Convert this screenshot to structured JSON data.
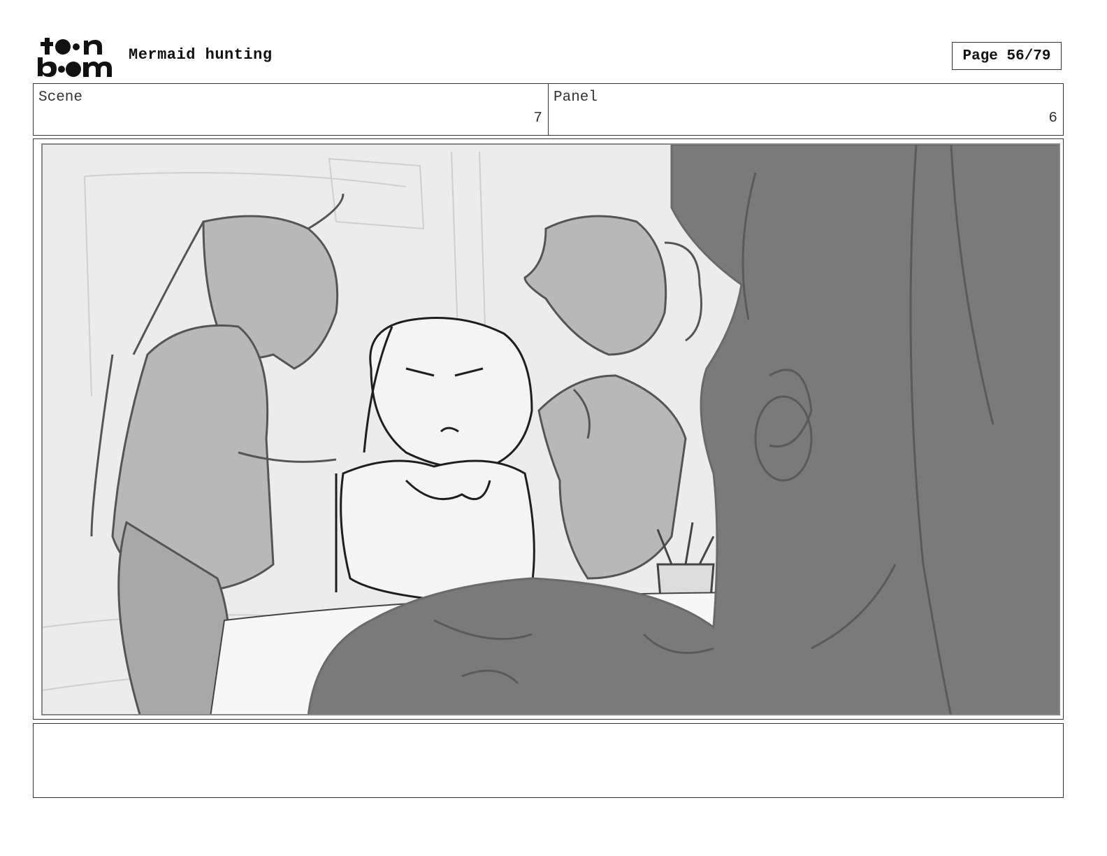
{
  "header": {
    "logo_text_line1": "toon",
    "logo_text_line2": "boom",
    "project_title": "Mermaid hunting",
    "page_indicator": "Page 56/79"
  },
  "info": {
    "scene_label": "Scene",
    "scene_value": "7",
    "panel_label": "Panel",
    "panel_value": "6"
  },
  "panel_image": {
    "icon": "storyboard-sketch"
  },
  "notes": {
    "text": ""
  }
}
